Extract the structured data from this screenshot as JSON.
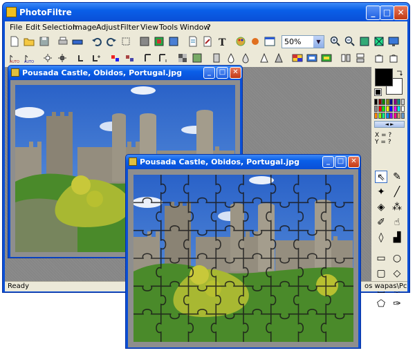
{
  "app": {
    "title": "PhotoFiltre"
  },
  "menu": [
    "File",
    "Edit",
    "Selection",
    "Image",
    "Adjust",
    "Filter",
    "View",
    "Tools",
    "Window",
    "?"
  ],
  "toolbar": {
    "zoom_value": "50%"
  },
  "colors": {
    "foreground": "#000000",
    "background": "#ffffff",
    "xp_blue": "#0a4fd6",
    "sky": "#3a78d8"
  },
  "coords": {
    "x_label": "X = ?",
    "y_label": "Y = ?"
  },
  "status": {
    "left": "Ready",
    "right": "os wapas\\Pc"
  },
  "image_window_1": {
    "title": "Pousada Castle, Obidos, Portugal.jpg"
  },
  "image_window_2": {
    "title": "Pousada Castle, Obidos, Portugal.jpg"
  },
  "tools": [
    "select-arrow",
    "eyedropper",
    "magic-wand",
    "line",
    "paint-bucket",
    "spray",
    "brush",
    "smudge",
    "blur-drop",
    "stamp",
    "rectangle",
    "ellipse",
    "rounded-rect",
    "diamond",
    "triangle",
    "lasso",
    "polygon",
    "freeform"
  ]
}
